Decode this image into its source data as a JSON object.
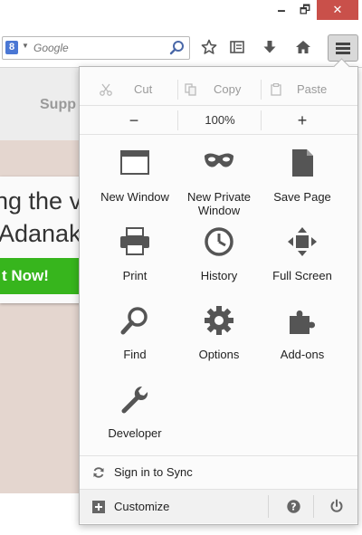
{
  "window": {
    "minimize_glyph": "🗕",
    "maximize_glyph": "🗗",
    "close_glyph": "✕"
  },
  "search": {
    "engine_badge": "8",
    "placeholder": "Google"
  },
  "page_behind": {
    "supp_text": "Supp",
    "headline_1": "ng the v",
    "headline_2": "Adanak",
    "cta": "t Now!"
  },
  "menu": {
    "edit": {
      "cut": "Cut",
      "copy": "Copy",
      "paste": "Paste"
    },
    "zoom": {
      "out": "−",
      "level": "100%",
      "in": "+"
    },
    "items": [
      {
        "label": "New Window",
        "icon": "new-window-icon"
      },
      {
        "label": "New Private Window",
        "icon": "private-mask-icon"
      },
      {
        "label": "Save Page",
        "icon": "save-page-icon"
      },
      {
        "label": "Print",
        "icon": "printer-icon"
      },
      {
        "label": "History",
        "icon": "clock-icon"
      },
      {
        "label": "Full Screen",
        "icon": "fullscreen-icon"
      },
      {
        "label": "Find",
        "icon": "magnifier-icon"
      },
      {
        "label": "Options",
        "icon": "gear-icon"
      },
      {
        "label": "Add-ons",
        "icon": "puzzle-icon"
      },
      {
        "label": "Developer",
        "icon": "wrench-icon"
      }
    ],
    "sync": "Sign in to Sync",
    "customize": "Customize"
  },
  "colors": {
    "close_button": "#c9504a",
    "cta_green": "#37b51d",
    "page_band": "#e4d6cf",
    "icon_gray": "#555555"
  }
}
